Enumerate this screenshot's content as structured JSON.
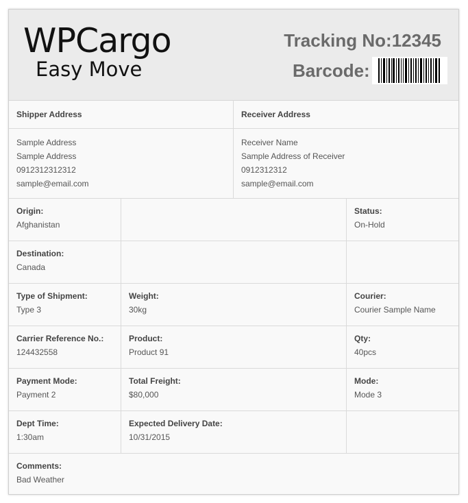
{
  "header": {
    "logo_main": "WPCargo",
    "logo_sub": "Easy Move",
    "tracking": "Tracking No:12345",
    "barcode_label": "Barcode:"
  },
  "addresses": {
    "shipper_title": "Shipper Address",
    "receiver_title": "Receiver Address",
    "shipper_lines": [
      "Sample Address",
      "Sample Address",
      "0912312312312",
      "sample@email.com"
    ],
    "receiver_lines": [
      "Receiver Name",
      "Sample Address of Receiver",
      "0912312312",
      "sample@email.com"
    ]
  },
  "fields": {
    "origin": {
      "label": "Origin:",
      "value": "Afghanistan"
    },
    "status": {
      "label": "Status:",
      "value": "On-Hold"
    },
    "destination": {
      "label": "Destination:",
      "value": "Canada"
    },
    "type": {
      "label": "Type of Shipment:",
      "value": "Type 3"
    },
    "weight": {
      "label": "Weight:",
      "value": "30kg"
    },
    "courier": {
      "label": "Courier:",
      "value": "Courier Sample Name"
    },
    "carrier_ref": {
      "label": "Carrier Reference No.:",
      "value": "124432558"
    },
    "product": {
      "label": "Product:",
      "value": "Product 91"
    },
    "qty": {
      "label": "Qty:",
      "value": "40pcs"
    },
    "payment": {
      "label": "Payment Mode:",
      "value": "Payment 2"
    },
    "freight": {
      "label": "Total Freight:",
      "value": "$80,000"
    },
    "mode": {
      "label": "Mode:",
      "value": "Mode 3"
    },
    "dept_time": {
      "label": "Dept Time:",
      "value": "1:30am"
    },
    "delivery": {
      "label": "Expected Delivery Date:",
      "value": "10/31/2015"
    },
    "comments": {
      "label": "Comments:",
      "value": "Bad Weather"
    }
  }
}
